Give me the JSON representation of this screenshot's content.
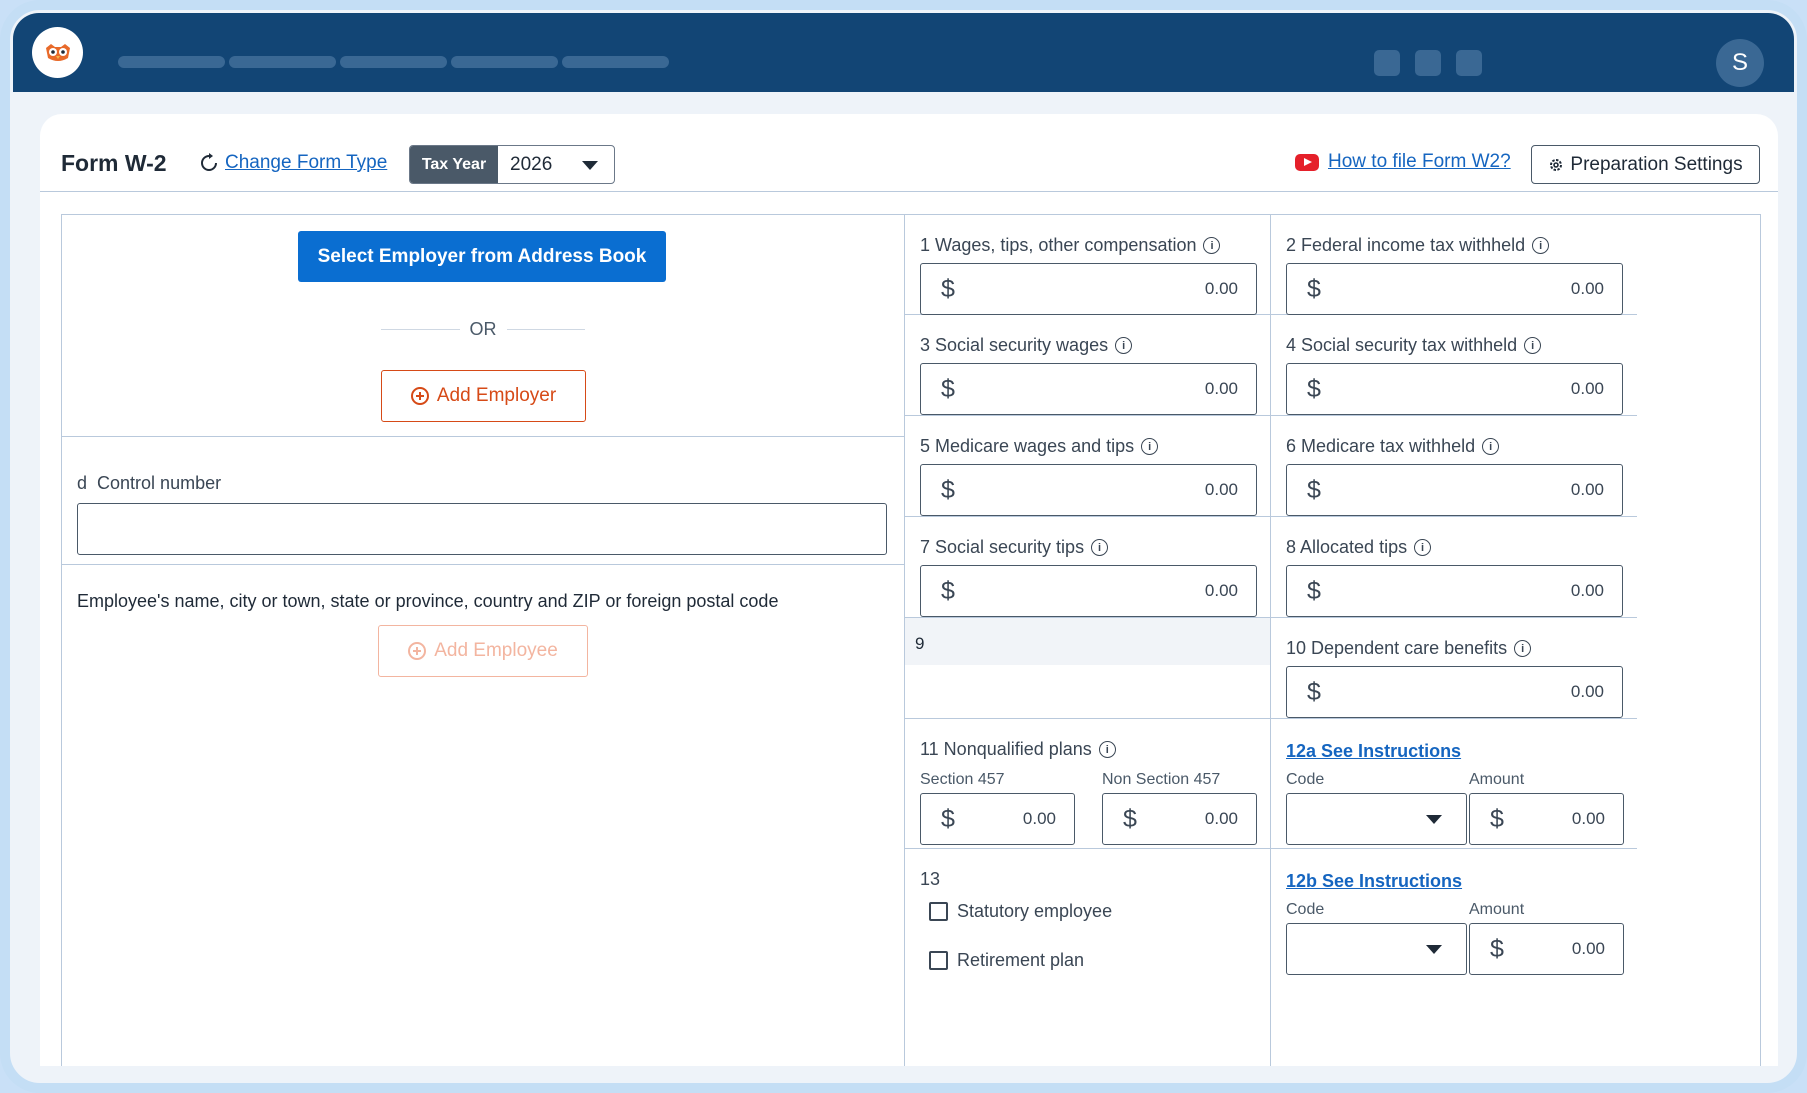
{
  "app": {
    "logo_icon": "owl-logo-icon",
    "avatar_letter": "S",
    "nav_placeholders": 5,
    "top_icons": 3
  },
  "header": {
    "title": "Form W-2",
    "change_link": "Change Form Type",
    "tax_year_label": "Tax Year",
    "tax_year_value": "2026",
    "howto_link": "How to file Form W2?",
    "prep_settings": "Preparation Settings"
  },
  "employer": {
    "select_button": "Select Employer from Address Book",
    "or_text": "OR",
    "add_button": "Add Employer"
  },
  "control": {
    "label_letter": "d",
    "label": "Control number",
    "value": ""
  },
  "employee": {
    "label": "Employee's name, city or town, state or province, country and ZIP or foreign postal code",
    "add_button": "Add Employee"
  },
  "boxes": {
    "b1": {
      "label": "1  Wages, tips, other compensation",
      "currency": "$",
      "value": "0.00"
    },
    "b2": {
      "label": "2  Federal income tax withheld",
      "currency": "$",
      "value": "0.00"
    },
    "b3": {
      "label": "3  Social security wages",
      "currency": "$",
      "value": "0.00"
    },
    "b4": {
      "label": "4  Social security tax withheld",
      "currency": "$",
      "value": "0.00"
    },
    "b5": {
      "label": "5  Medicare wages and tips",
      "currency": "$",
      "value": "0.00"
    },
    "b6": {
      "label": "6  Medicare tax withheld",
      "currency": "$",
      "value": "0.00"
    },
    "b7": {
      "label": "7  Social security tips",
      "currency": "$",
      "value": "0.00"
    },
    "b8": {
      "label": "8  Allocated tips",
      "currency": "$",
      "value": "0.00"
    },
    "b9": {
      "label": "9"
    },
    "b10": {
      "label": "10 Dependent care benefits",
      "currency": "$",
      "value": "0.00"
    },
    "b11": {
      "label": "11  Nonqualified plans",
      "sec457_label": "Section 457",
      "sec457_value": "0.00",
      "nonsec457_label": "Non Section 457",
      "nonsec457_value": "0.00",
      "currency": "$"
    },
    "b12a": {
      "link": "12a See Instructions",
      "code_label": "Code",
      "amount_label": "Amount",
      "currency": "$",
      "amount_value": "0.00"
    },
    "b12b": {
      "link": "12b See Instructions",
      "code_label": "Code",
      "amount_label": "Amount",
      "currency": "$",
      "amount_value": "0.00"
    },
    "b13": {
      "label": "13",
      "statutory": "Statutory employee",
      "retirement": "Retirement plan"
    }
  },
  "colors": {
    "topbar": "#124575",
    "primary": "#0a6ed1",
    "accent_orange": "#d64a17",
    "link": "#1565c0"
  }
}
